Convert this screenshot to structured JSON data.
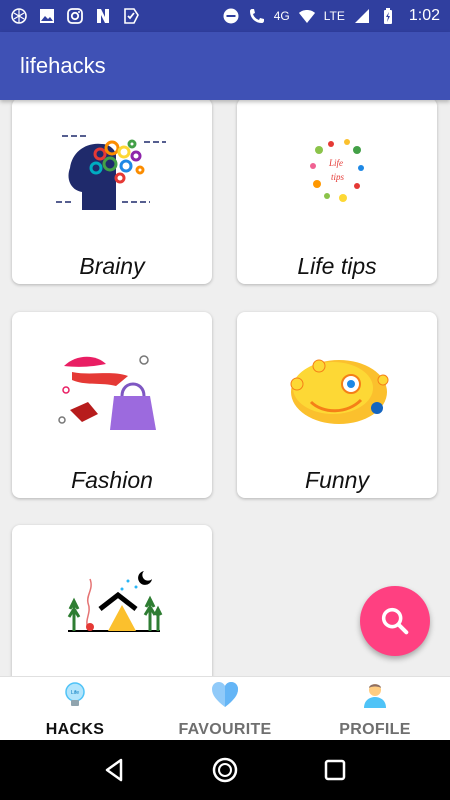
{
  "status_bar": {
    "time": "1:02",
    "network": "LTE",
    "signal_label": "4G",
    "left_icons": [
      "app-icon",
      "image-icon",
      "instagram-icon",
      "n-icon",
      "download-check-icon"
    ],
    "right_icons": [
      "do-not-disturb-icon",
      "phone-4g-icon",
      "wifi-icon",
      "signal-icon",
      "battery-charging-icon"
    ],
    "bg_color": "#303f9f"
  },
  "app_bar": {
    "title": "lifehacks",
    "bg_color": "#3f51b5"
  },
  "categories": [
    {
      "label": "Brainy",
      "icon": "brain-gears-illustration"
    },
    {
      "label": "Life tips",
      "icon": "life-tips-illustration"
    },
    {
      "label": "Fashion",
      "icon": "fashion-illustration"
    },
    {
      "label": "Funny",
      "icon": "funny-emoji-illustration"
    },
    {
      "label": "",
      "icon": "camping-illustration"
    }
  ],
  "fab": {
    "icon": "search-icon",
    "color": "#ff4081"
  },
  "bottom_nav": {
    "items": [
      {
        "label": "HACKS",
        "icon": "lightbulb-icon",
        "active": true
      },
      {
        "label": "FAVOURITE",
        "icon": "heart-icon",
        "active": false
      },
      {
        "label": "PROFILE",
        "icon": "person-icon",
        "active": false
      }
    ]
  },
  "system_nav": {
    "buttons": [
      "back-icon",
      "home-icon",
      "recents-icon"
    ]
  }
}
